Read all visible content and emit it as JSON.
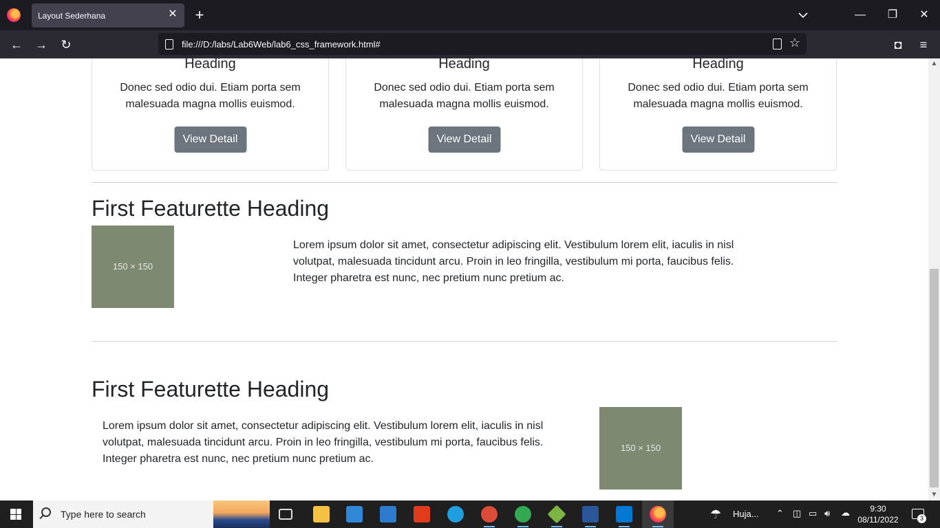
{
  "browser": {
    "tab_title": "Layout Sederhana",
    "url": "file:///D:/labs/Lab6Web/lab6_css_framework.html#",
    "tab_close": "✕",
    "new_tab": "+",
    "minimize": "—",
    "restore": "❐",
    "close": "✕",
    "back": "←",
    "forward": "→",
    "reload": "↻",
    "bookmark": "☆",
    "pocket": "◘",
    "menu": "≡"
  },
  "cards": [
    {
      "heading": "Heading",
      "text": "Donec sed odio dui. Etiam porta sem malesuada magna mollis euismod.",
      "button": "View Detail"
    },
    {
      "heading": "Heading",
      "text": "Donec sed odio dui. Etiam porta sem malesuada magna mollis euismod.",
      "button": "View Detail"
    },
    {
      "heading": "Heading",
      "text": "Donec sed odio dui. Etiam porta sem malesuada magna mollis euismod.",
      "button": "View Detail"
    }
  ],
  "featurettes": [
    {
      "heading": "First Featurette Heading",
      "placeholder": "150 × 150",
      "text": "Lorem ipsum dolor sit amet, consectetur adipiscing elit. Vestibulum lorem elit, iaculis in nisl volutpat, malesuada tincidunt arcu. Proin in leo fringilla, vestibulum mi porta, faucibus felis. Integer pharetra est nunc, nec pretium nunc pretium ac."
    },
    {
      "heading": "First Featurette Heading",
      "placeholder": "150 × 150",
      "text": "Lorem ipsum dolor sit amet, consectetur adipiscing elit. Vestibulum lorem elit, iaculis in nisl volutpat, malesuada tincidunt arcu. Proin in leo fringilla, vestibulum mi porta, faucibus felis. Integer pharetra est nunc, nec pretium nunc pretium ac."
    }
  ],
  "taskbar": {
    "search_placeholder": "Type here to search",
    "weather": "Huja...",
    "time": "9:30",
    "date": "08/11/2022",
    "notification_count": "3"
  },
  "colors": {
    "button_bg": "#6c757d",
    "placeholder_bg": "#7d8a71",
    "chrome_dark": "#1c1b22",
    "toolbar": "#2b2a33"
  }
}
